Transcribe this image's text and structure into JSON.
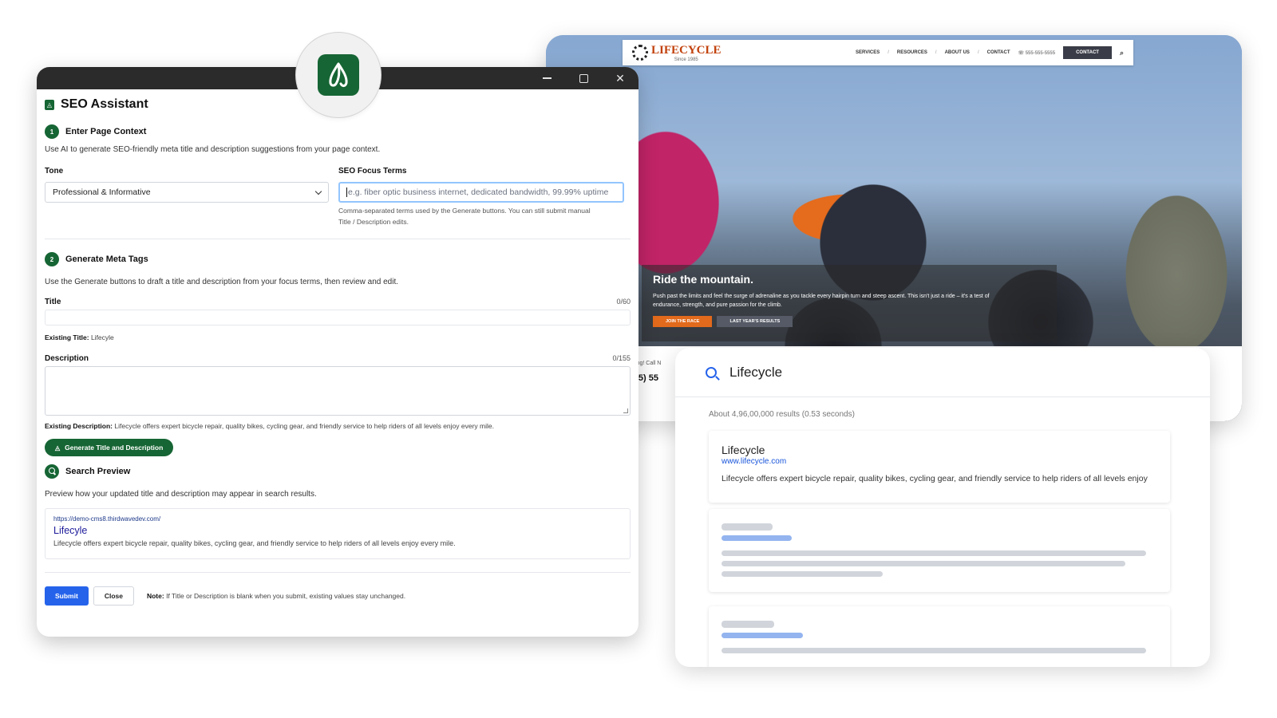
{
  "site": {
    "logo_text": "LIFECYCLE",
    "logo_sub": "Since 1985",
    "nav": [
      "SERVICES",
      "RESOURCES",
      "ABOUT US",
      "CONTACT"
    ],
    "phone": "555-555-5555",
    "contact_button": "CONTACT",
    "hero_title": "Ride the mountain.",
    "hero_text": "Push past the limits and feel the surge of adrenaline as you tackle every hairpin turn and steep ascent. This isn't just a ride – it's a test of endurance, strength, and pure passion for the climb.",
    "hero_btn1": "JOIN THE RACE",
    "hero_btn2": "LAST YEAR'S RESULTS",
    "strip_text": "Rolling! Call N",
    "strip_phone": "(555) 55"
  },
  "search": {
    "query": "Lifecycle",
    "stats": "About 4,96,00,000 results (0.53 seconds)",
    "result": {
      "title": "Lifecycle",
      "url_prefix": "www.",
      "url_domain": "lifecycle",
      "url_suffix": ".com",
      "description": "Lifecycle offers expert bicycle repair, quality bikes, cycling gear, and friendly service to help riders of all levels enjoy"
    }
  },
  "seo": {
    "app_title": "SEO Assistant",
    "steps": {
      "one": {
        "num": "1",
        "title": "Enter Page Context"
      },
      "two": {
        "num": "2",
        "title": "Generate Meta Tags"
      },
      "three": {
        "title": "Search Preview"
      }
    },
    "context_help": "Use AI to generate SEO-friendly meta title and description suggestions from your page context.",
    "tone_label": "Tone",
    "tone_value": "Professional & Informative",
    "focus_label": "SEO Focus Terms",
    "focus_placeholder": "e.g. fiber optic business internet, dedicated bandwidth, 99.99% uptime",
    "focus_hint_line1": "Comma-separated terms used by the Generate buttons. You can still submit manual",
    "focus_hint_line2": "Title / Description edits.",
    "generate_help": "Use the Generate buttons to draft a title and description from your focus terms, then review and edit.",
    "title_label": "Title",
    "title_count": "0/60",
    "existing_title_label": "Existing Title:",
    "existing_title_value": "Lifecyle",
    "desc_label": "Description",
    "desc_count": "0/155",
    "existing_desc_label": "Existing Description:",
    "existing_desc_value": "Lifecycle offers expert bicycle repair, quality bikes, cycling gear, and friendly service to help riders of all levels enjoy every mile.",
    "generate_button": "Generate Title and Description",
    "preview_help": "Preview how your updated title and description may appear in search results.",
    "preview_url": "https://demo-cms8.thirdwavedev.com/",
    "preview_title": "Lifecyle",
    "preview_desc": "Lifecycle offers expert bicycle repair, quality bikes, cycling gear, and friendly service to help riders of all levels enjoy every mile.",
    "submit_button": "Submit",
    "close_button": "Close",
    "note_label": "Note:",
    "note_text": "If Title or Description is blank when you submit, existing values stay unchanged."
  },
  "colors": {
    "brand_green": "#166534",
    "accent_blue": "#2563eb",
    "site_orange": "#e26a1c"
  }
}
